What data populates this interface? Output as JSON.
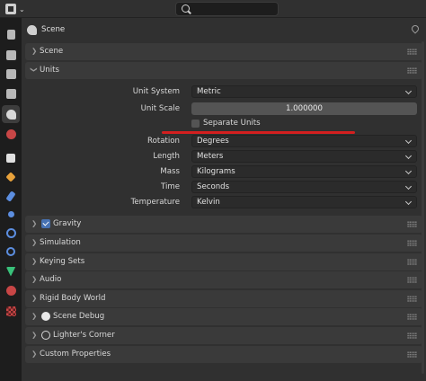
{
  "context_title": "Scene",
  "panels": {
    "scene": "Scene",
    "units": "Units",
    "gravity": "Gravity",
    "simulation": "Simulation",
    "keying_sets": "Keying Sets",
    "audio": "Audio",
    "rigid_body_world": "Rigid Body World",
    "scene_debug": "Scene Debug",
    "lighters_corner": "Lighter's Corner",
    "custom_properties": "Custom Properties"
  },
  "units": {
    "unit_system_label": "Unit System",
    "unit_system_value": "Metric",
    "unit_scale_label": "Unit Scale",
    "unit_scale_value": "1.000000",
    "separate_units_label": "Separate Units",
    "rotation_label": "Rotation",
    "rotation_value": "Degrees",
    "length_label": "Length",
    "length_value": "Meters",
    "mass_label": "Mass",
    "mass_value": "Kilograms",
    "time_label": "Time",
    "time_value": "Seconds",
    "temperature_label": "Temperature",
    "temperature_value": "Kelvin"
  },
  "tabs": [
    {
      "icon": "tool-icon",
      "color": "#b0b0b0"
    },
    {
      "icon": "render-icon",
      "color": "#b0b0b0"
    },
    {
      "icon": "output-icon",
      "color": "#b0b0b0"
    },
    {
      "icon": "view-layer-icon",
      "color": "#b0b0b0"
    },
    {
      "icon": "scene-icon",
      "color": "#d0d0d0"
    },
    {
      "icon": "world-icon",
      "color": "#d04a4a"
    },
    {
      "icon": "collection-icon",
      "color": "#e9a23b"
    },
    {
      "icon": "object-icon",
      "color": "#e9a23b"
    },
    {
      "icon": "modifier-icon",
      "color": "#5c8ee0"
    },
    {
      "icon": "particles-icon",
      "color": "#5c8ee0"
    },
    {
      "icon": "physics-icon",
      "color": "#5c8ee0"
    },
    {
      "icon": "constraints-icon",
      "color": "#5c8ee0"
    },
    {
      "icon": "data-icon",
      "color": "#39c17a"
    },
    {
      "icon": "material-icon",
      "color": "#d04a4a"
    },
    {
      "icon": "texture-icon",
      "color": "#d04a4a"
    }
  ],
  "colors": {
    "accent": "#4772b3",
    "annotation": "#d41f1f"
  }
}
